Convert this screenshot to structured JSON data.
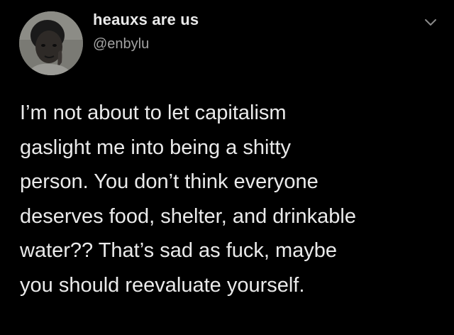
{
  "user": {
    "display_name": "heauxs are us",
    "handle": "@enbylu"
  },
  "tweet": {
    "lines": [
      "I’m not about to let capitalism",
      "gaslight me into being a shitty",
      "person. You don’t think everyone",
      "deserves food, shelter, and drinkable",
      "water?? That’s sad as fuck, maybe",
      "you should reevaluate yourself."
    ]
  },
  "icons": {
    "avatar": "user-avatar",
    "menu": "chevron-down-icon"
  },
  "colors": {
    "background": "#000000",
    "name_text": "#eaeaea",
    "handle_text": "#a3a3a3",
    "body_text": "#eaeaea"
  }
}
